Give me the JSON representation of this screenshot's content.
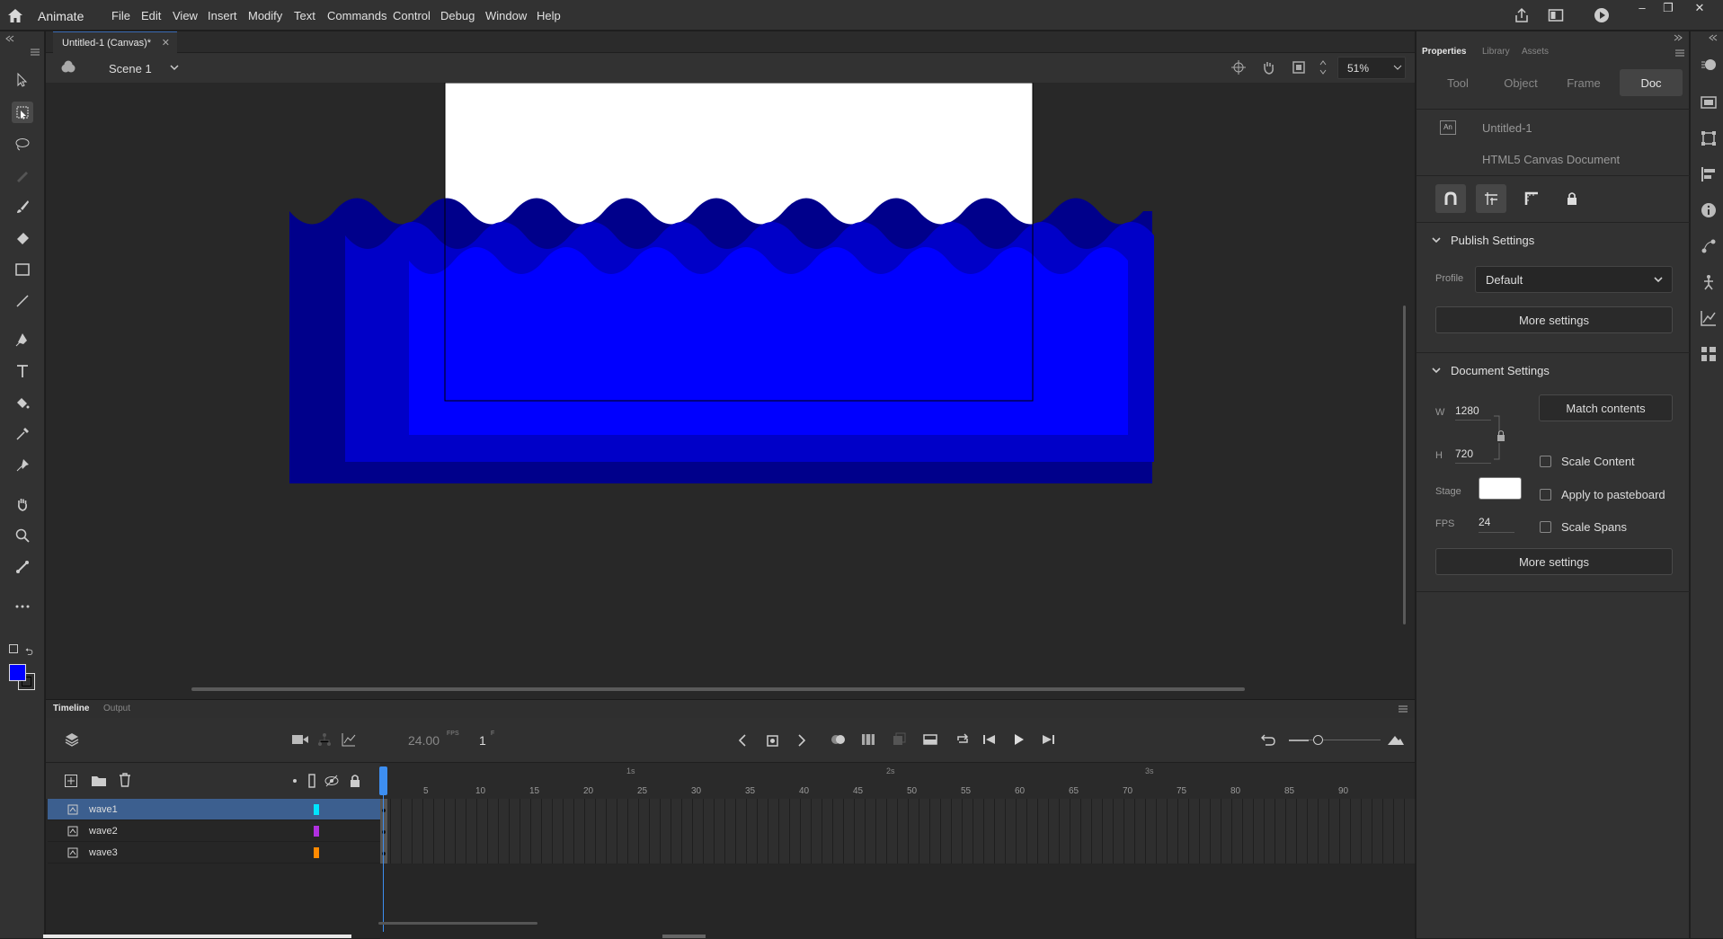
{
  "app": {
    "name": "Animate",
    "menu": [
      "File",
      "Edit",
      "View",
      "Insert",
      "Modify",
      "Text",
      "Commands",
      "Control",
      "Debug",
      "Window",
      "Help"
    ]
  },
  "document": {
    "tab_title": "Untitled-1 (Canvas)*",
    "scene": "Scene 1",
    "zoom": "51%"
  },
  "colors": {
    "fill": "#0000ff",
    "stroke": "#000000",
    "wave_back": "#00008b",
    "wave_mid": "#0000c8",
    "wave_front": "#0000ff",
    "accent": "#3c5f8f"
  },
  "timeline": {
    "tabs": [
      "Timeline",
      "Output"
    ],
    "fps": "24.00",
    "fps_unit": "FPS",
    "current_frame": "1",
    "frame_unit": "F",
    "layers": [
      {
        "name": "wave1",
        "color": "#00e5ff",
        "selected": true
      },
      {
        "name": "wave2",
        "color": "#b030e0",
        "selected": false
      },
      {
        "name": "wave3",
        "color": "#ff8a00",
        "selected": false
      }
    ],
    "frame_ticks": [
      "5",
      "10",
      "15",
      "20",
      "25",
      "30",
      "35",
      "40",
      "45",
      "50",
      "55",
      "60",
      "65",
      "70",
      "75",
      "80",
      "85",
      "90"
    ],
    "second_marks": [
      "1s",
      "2s",
      "3s"
    ]
  },
  "properties": {
    "panel_tabs": [
      "Properties",
      "Library",
      "Assets"
    ],
    "sub_tabs": [
      "Tool",
      "Object",
      "Frame",
      "Doc"
    ],
    "active_sub_tab": "Doc",
    "doc_icon_text": "An",
    "doc_name": "Untitled-1",
    "doc_type": "HTML5 Canvas Document",
    "publish": {
      "title": "Publish Settings",
      "profile_label": "Profile",
      "profile_value": "Default",
      "more": "More settings"
    },
    "document_settings": {
      "title": "Document Settings",
      "w_label": "W",
      "w_value": "1280",
      "h_label": "H",
      "h_value": "720",
      "match_contents": "Match contents",
      "scale_content": "Scale Content",
      "stage_label": "Stage",
      "stage_color": "#ffffff",
      "apply_pasteboard": "Apply to pasteboard",
      "fps_label": "FPS",
      "fps_value": "24",
      "scale_spans": "Scale Spans",
      "more": "More settings"
    }
  }
}
